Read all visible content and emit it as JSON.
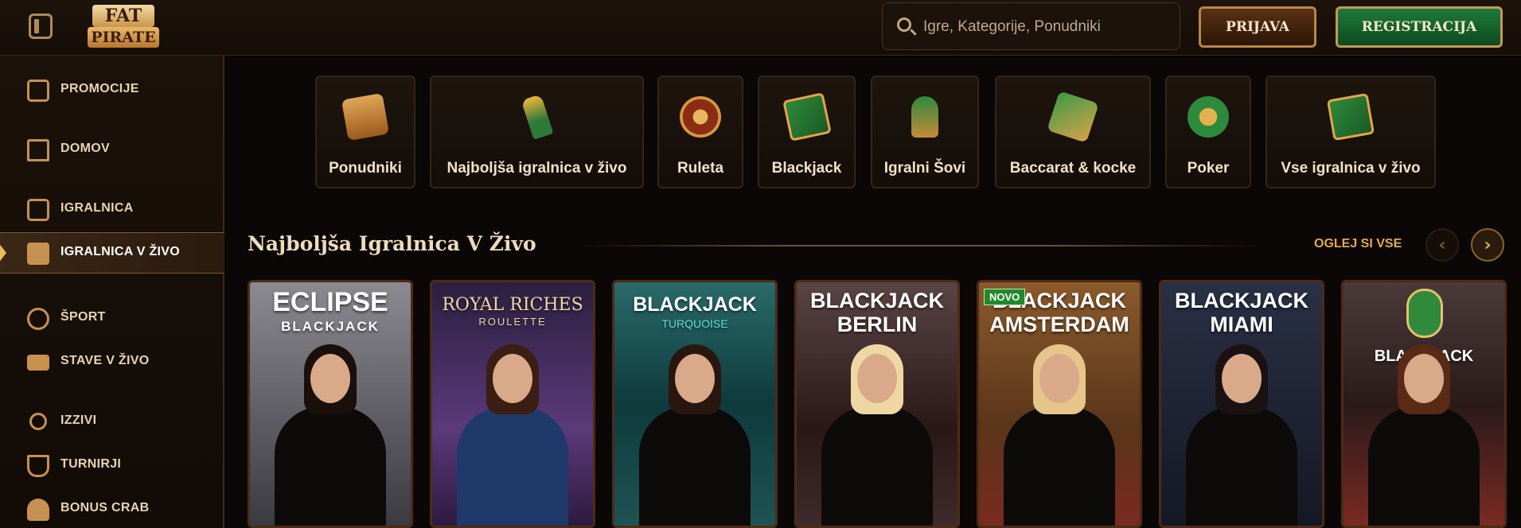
{
  "header": {
    "logo_line1": "FAT",
    "logo_line2": "PIRATE",
    "search_placeholder": "Igre, Kategorije, Ponudniki",
    "login_label": "PRIJAVA",
    "register_label": "REGISTRACIJA"
  },
  "sidebar": {
    "items": [
      {
        "label": "PROMOCIJE",
        "icon": "gift-chest-icon"
      },
      {
        "label": "DOMOV",
        "icon": "home-icon"
      },
      {
        "label": "IGRALNICA",
        "icon": "slot-machine-icon"
      },
      {
        "label": "IGRALNICA V ŽIVO",
        "icon": "live-casino-icon",
        "active": true
      },
      {
        "label": "ŠPORT",
        "icon": "soccer-ball-icon"
      },
      {
        "label": "STAVE V ŽIVO",
        "icon": "live-badge-icon"
      },
      {
        "label": "IZZIVI",
        "icon": "medal-icon"
      },
      {
        "label": "TURNIRJI",
        "icon": "trophy-icon"
      },
      {
        "label": "BONUS CRAB",
        "icon": "crab-icon"
      }
    ]
  },
  "categories": [
    {
      "label": "Ponudniki",
      "icon": "scroll-icon"
    },
    {
      "label": "Najboljša igralnica v živo",
      "icon": "torch-icon"
    },
    {
      "label": "Ruleta",
      "icon": "roulette-wheel-icon"
    },
    {
      "label": "Blackjack",
      "icon": "cards-icon"
    },
    {
      "label": "Igralni Šovi",
      "icon": "microphone-icon"
    },
    {
      "label": "Baccarat & kocke",
      "icon": "dice-icon"
    },
    {
      "label": "Poker",
      "icon": "poker-chips-icon"
    },
    {
      "label": "Vse igralnica v živo",
      "icon": "all-cards-icon"
    }
  ],
  "section": {
    "title": "Najboljša Igralnica V Živo",
    "see_all": "OGLEJ SI VSE"
  },
  "games": [
    {
      "line1": "ECLIPSE",
      "line2": "BLACKJACK",
      "badge": "",
      "bg": "#6e6e72"
    },
    {
      "line1": "ROYAL RICHES",
      "line2": "ROULETTE",
      "badge": "",
      "bg": "#3b2a5c"
    },
    {
      "line1": "BLACKJACK",
      "line2": "TURQUOISE",
      "badge": "",
      "bg": "#1d5c5a"
    },
    {
      "line1": "BLACKJACK",
      "line2": "BERLIN",
      "badge": "",
      "bg": "#4a2a2a"
    },
    {
      "line1": "BLACKJACK",
      "line2": "AMSTERDAM",
      "badge": "NOVO",
      "bg": "#7a4a22"
    },
    {
      "line1": "BLACKJACK",
      "line2": "MIAMI",
      "badge": "",
      "bg": "#1c2435"
    },
    {
      "line1": "BLACKJACK",
      "line2": "",
      "badge": "",
      "bg": "#5a3a38"
    }
  ]
}
